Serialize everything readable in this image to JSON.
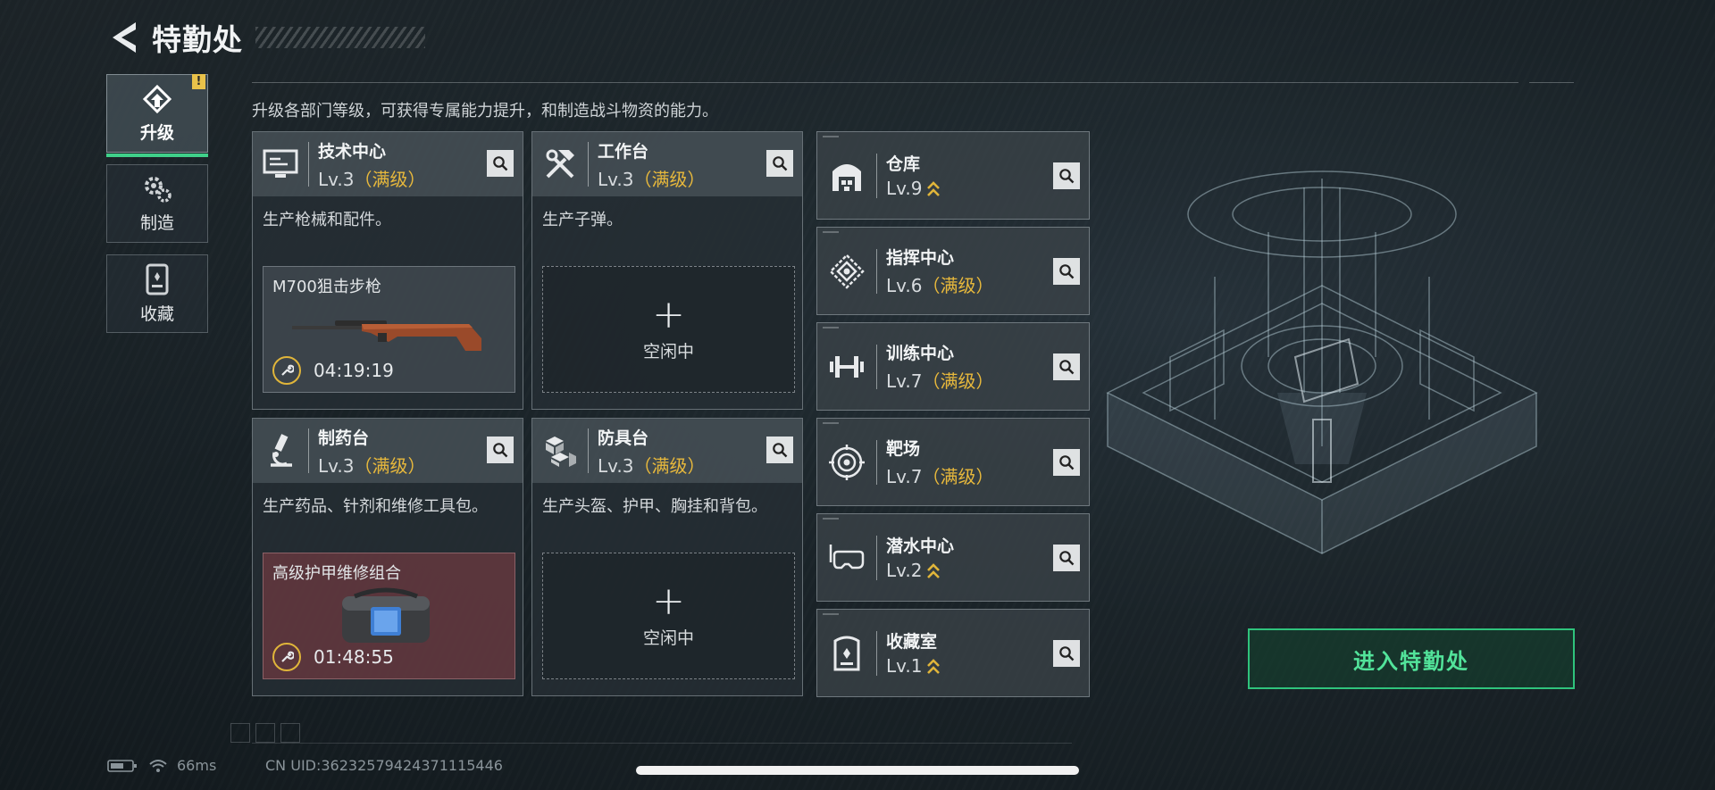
{
  "header": {
    "title": "特勤处"
  },
  "sidebar": {
    "items": [
      {
        "label": "升级",
        "badge": "!"
      },
      {
        "label": "制造"
      },
      {
        "label": "收藏"
      }
    ]
  },
  "main": {
    "description": "升级各部门等级，可获得专属能力提升，和制造战斗物资的能力。"
  },
  "cards": [
    {
      "name": "技术中心",
      "level": "Lv.3",
      "status": "（满级）",
      "desc": "生产枪械和配件。",
      "production": {
        "item": "M700狙击步枪",
        "timer": "04:19:19"
      }
    },
    {
      "name": "工作台",
      "level": "Lv.3",
      "status": "（满级）",
      "desc": "生产子弹。",
      "idle_label": "空闲中"
    },
    {
      "name": "制药台",
      "level": "Lv.3",
      "status": "（满级）",
      "desc": "生产药品、针剂和维修工具包。",
      "production": {
        "item": "高级护甲维修组合",
        "timer": "01:48:55"
      }
    },
    {
      "name": "防具台",
      "level": "Lv.3",
      "status": "（满级）",
      "desc": "生产头盔、护甲、胸挂和背包。",
      "idle_label": "空闲中"
    }
  ],
  "facilities": [
    {
      "name": "仓库",
      "level": "Lv.9",
      "status": "",
      "upgradable": true,
      "icon": "warehouse-icon"
    },
    {
      "name": "指挥中心",
      "level": "Lv.6",
      "status": "（满级）",
      "upgradable": false,
      "icon": "command-icon"
    },
    {
      "name": "训练中心",
      "level": "Lv.7",
      "status": "（满级）",
      "upgradable": false,
      "icon": "dumbbell-icon"
    },
    {
      "name": "靶场",
      "level": "Lv.7",
      "status": "（满级）",
      "upgradable": false,
      "icon": "target-icon"
    },
    {
      "name": "潜水中心",
      "level": "Lv.2",
      "status": "",
      "upgradable": true,
      "icon": "diving-mask-icon"
    },
    {
      "name": "收藏室",
      "level": "Lv.1",
      "status": "",
      "upgradable": true,
      "icon": "trophy-icon"
    }
  ],
  "enter_button": {
    "label": "进入特勤处"
  },
  "status_bar": {
    "ping": "66ms",
    "uid": "CN UID:3623257942437111544б"
  },
  "colors": {
    "accent_green": "#3fd08a",
    "max_level": "#e7b83c",
    "upgrade_arrow": "#e0b53a"
  }
}
